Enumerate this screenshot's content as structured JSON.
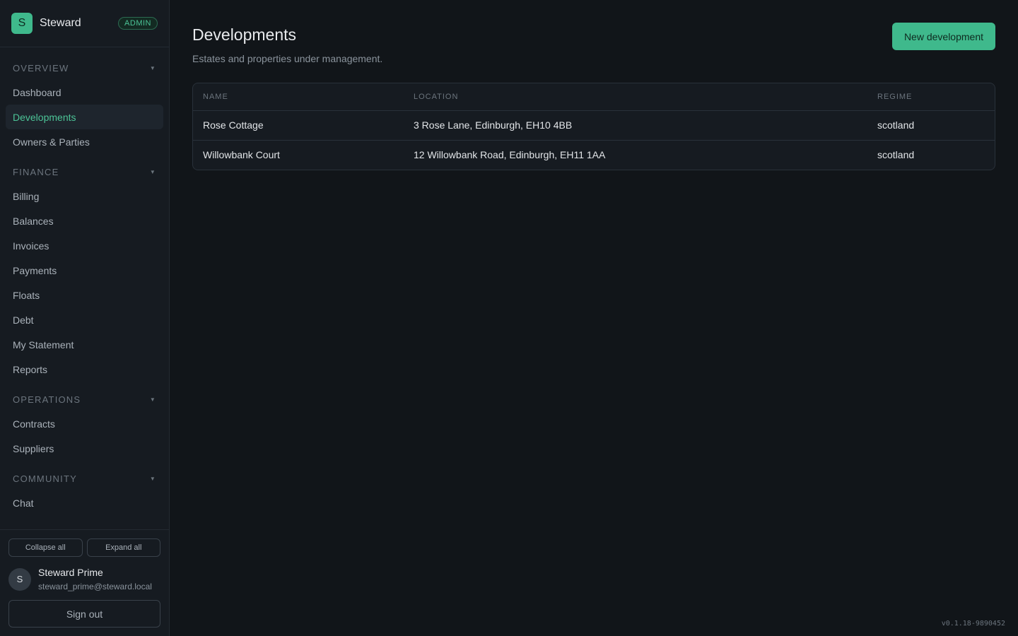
{
  "brand": {
    "logo_letter": "S",
    "name": "Steward",
    "badge": "ADMIN"
  },
  "nav": {
    "sections": [
      {
        "title": "OVERVIEW",
        "items": [
          "Dashboard",
          "Developments",
          "Owners & Parties"
        ]
      },
      {
        "title": "FINANCE",
        "items": [
          "Billing",
          "Balances",
          "Invoices",
          "Payments",
          "Floats",
          "Debt",
          "My Statement",
          "Reports"
        ]
      },
      {
        "title": "OPERATIONS",
        "items": [
          "Contracts",
          "Suppliers"
        ]
      },
      {
        "title": "COMMUNITY",
        "items": [
          "Chat"
        ]
      }
    ],
    "active": "Developments"
  },
  "footer": {
    "collapse_all": "Collapse all",
    "expand_all": "Expand all",
    "user": {
      "avatar": "S",
      "name": "Steward Prime",
      "email": "steward_prime@steward.local"
    },
    "sign_out": "Sign out"
  },
  "page": {
    "title": "Developments",
    "subtitle": "Estates and properties under management.",
    "new_button": "New development"
  },
  "table": {
    "columns": [
      "NAME",
      "LOCATION",
      "REGIME"
    ],
    "rows": [
      {
        "name": "Rose Cottage",
        "location": "3 Rose Lane, Edinburgh, EH10 4BB",
        "regime": "scotland"
      },
      {
        "name": "Willowbank Court",
        "location": "12 Willowbank Road, Edinburgh, EH11 1AA",
        "regime": "scotland"
      }
    ]
  },
  "version": "v0.1.18-9890452",
  "colors": {
    "accent": "#3fb98c",
    "background": "#111519",
    "sidebar": "#161b21"
  }
}
